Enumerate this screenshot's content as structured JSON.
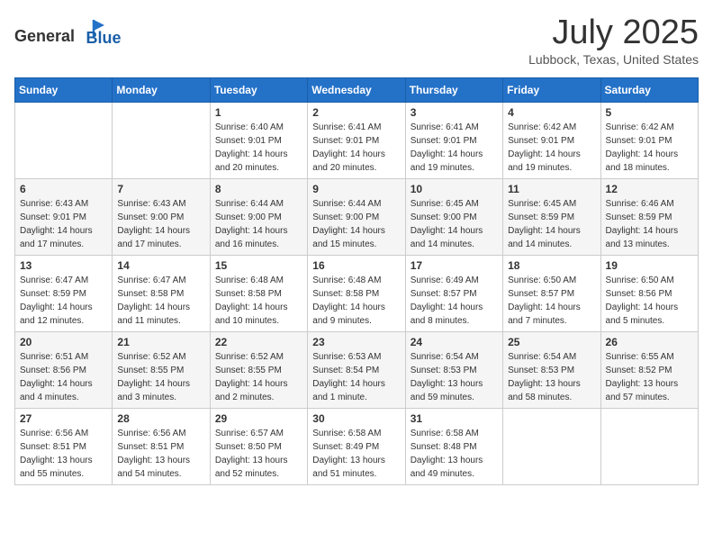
{
  "header": {
    "logo_general": "General",
    "logo_blue": "Blue",
    "month_title": "July 2025",
    "location": "Lubbock, Texas, United States"
  },
  "weekdays": [
    "Sunday",
    "Monday",
    "Tuesday",
    "Wednesday",
    "Thursday",
    "Friday",
    "Saturday"
  ],
  "weeks": [
    [
      {
        "day": "",
        "info": ""
      },
      {
        "day": "",
        "info": ""
      },
      {
        "day": "1",
        "info": "Sunrise: 6:40 AM\nSunset: 9:01 PM\nDaylight: 14 hours and 20 minutes."
      },
      {
        "day": "2",
        "info": "Sunrise: 6:41 AM\nSunset: 9:01 PM\nDaylight: 14 hours and 20 minutes."
      },
      {
        "day": "3",
        "info": "Sunrise: 6:41 AM\nSunset: 9:01 PM\nDaylight: 14 hours and 19 minutes."
      },
      {
        "day": "4",
        "info": "Sunrise: 6:42 AM\nSunset: 9:01 PM\nDaylight: 14 hours and 19 minutes."
      },
      {
        "day": "5",
        "info": "Sunrise: 6:42 AM\nSunset: 9:01 PM\nDaylight: 14 hours and 18 minutes."
      }
    ],
    [
      {
        "day": "6",
        "info": "Sunrise: 6:43 AM\nSunset: 9:01 PM\nDaylight: 14 hours and 17 minutes."
      },
      {
        "day": "7",
        "info": "Sunrise: 6:43 AM\nSunset: 9:00 PM\nDaylight: 14 hours and 17 minutes."
      },
      {
        "day": "8",
        "info": "Sunrise: 6:44 AM\nSunset: 9:00 PM\nDaylight: 14 hours and 16 minutes."
      },
      {
        "day": "9",
        "info": "Sunrise: 6:44 AM\nSunset: 9:00 PM\nDaylight: 14 hours and 15 minutes."
      },
      {
        "day": "10",
        "info": "Sunrise: 6:45 AM\nSunset: 9:00 PM\nDaylight: 14 hours and 14 minutes."
      },
      {
        "day": "11",
        "info": "Sunrise: 6:45 AM\nSunset: 8:59 PM\nDaylight: 14 hours and 14 minutes."
      },
      {
        "day": "12",
        "info": "Sunrise: 6:46 AM\nSunset: 8:59 PM\nDaylight: 14 hours and 13 minutes."
      }
    ],
    [
      {
        "day": "13",
        "info": "Sunrise: 6:47 AM\nSunset: 8:59 PM\nDaylight: 14 hours and 12 minutes."
      },
      {
        "day": "14",
        "info": "Sunrise: 6:47 AM\nSunset: 8:58 PM\nDaylight: 14 hours and 11 minutes."
      },
      {
        "day": "15",
        "info": "Sunrise: 6:48 AM\nSunset: 8:58 PM\nDaylight: 14 hours and 10 minutes."
      },
      {
        "day": "16",
        "info": "Sunrise: 6:48 AM\nSunset: 8:58 PM\nDaylight: 14 hours and 9 minutes."
      },
      {
        "day": "17",
        "info": "Sunrise: 6:49 AM\nSunset: 8:57 PM\nDaylight: 14 hours and 8 minutes."
      },
      {
        "day": "18",
        "info": "Sunrise: 6:50 AM\nSunset: 8:57 PM\nDaylight: 14 hours and 7 minutes."
      },
      {
        "day": "19",
        "info": "Sunrise: 6:50 AM\nSunset: 8:56 PM\nDaylight: 14 hours and 5 minutes."
      }
    ],
    [
      {
        "day": "20",
        "info": "Sunrise: 6:51 AM\nSunset: 8:56 PM\nDaylight: 14 hours and 4 minutes."
      },
      {
        "day": "21",
        "info": "Sunrise: 6:52 AM\nSunset: 8:55 PM\nDaylight: 14 hours and 3 minutes."
      },
      {
        "day": "22",
        "info": "Sunrise: 6:52 AM\nSunset: 8:55 PM\nDaylight: 14 hours and 2 minutes."
      },
      {
        "day": "23",
        "info": "Sunrise: 6:53 AM\nSunset: 8:54 PM\nDaylight: 14 hours and 1 minute."
      },
      {
        "day": "24",
        "info": "Sunrise: 6:54 AM\nSunset: 8:53 PM\nDaylight: 13 hours and 59 minutes."
      },
      {
        "day": "25",
        "info": "Sunrise: 6:54 AM\nSunset: 8:53 PM\nDaylight: 13 hours and 58 minutes."
      },
      {
        "day": "26",
        "info": "Sunrise: 6:55 AM\nSunset: 8:52 PM\nDaylight: 13 hours and 57 minutes."
      }
    ],
    [
      {
        "day": "27",
        "info": "Sunrise: 6:56 AM\nSunset: 8:51 PM\nDaylight: 13 hours and 55 minutes."
      },
      {
        "day": "28",
        "info": "Sunrise: 6:56 AM\nSunset: 8:51 PM\nDaylight: 13 hours and 54 minutes."
      },
      {
        "day": "29",
        "info": "Sunrise: 6:57 AM\nSunset: 8:50 PM\nDaylight: 13 hours and 52 minutes."
      },
      {
        "day": "30",
        "info": "Sunrise: 6:58 AM\nSunset: 8:49 PM\nDaylight: 13 hours and 51 minutes."
      },
      {
        "day": "31",
        "info": "Sunrise: 6:58 AM\nSunset: 8:48 PM\nDaylight: 13 hours and 49 minutes."
      },
      {
        "day": "",
        "info": ""
      },
      {
        "day": "",
        "info": ""
      }
    ]
  ]
}
